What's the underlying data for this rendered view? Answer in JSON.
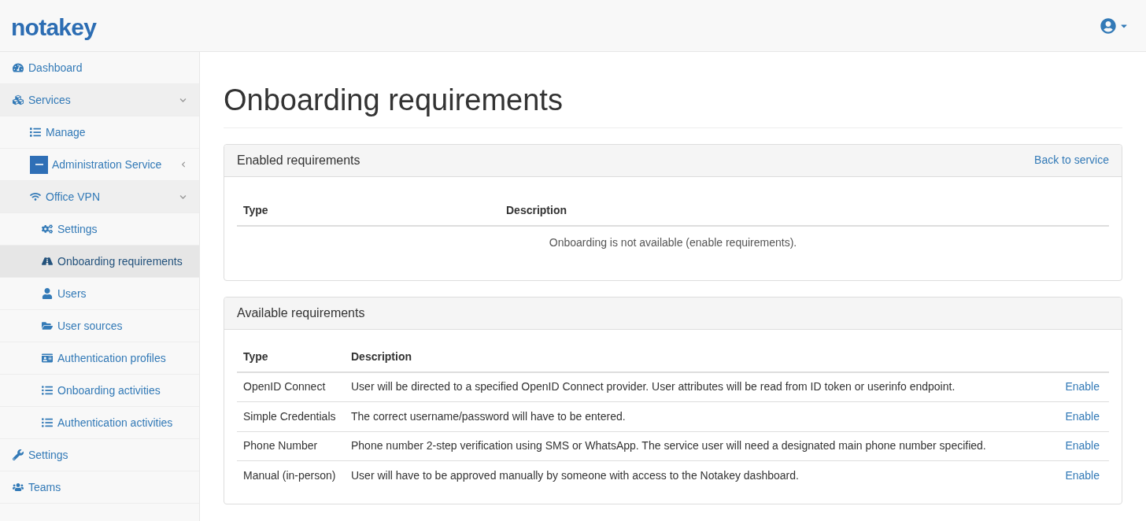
{
  "brand": {
    "name": "notakey"
  },
  "sidebar": {
    "items": [
      {
        "label": "Dashboard",
        "selected": false
      },
      {
        "label": "Services",
        "selected": false,
        "expanded": true,
        "children": [
          {
            "label": "Manage",
            "selected": false
          },
          {
            "label": "Administration Service",
            "selected": false,
            "expanded": false
          },
          {
            "label": "Office VPN",
            "selected": false,
            "expanded": true,
            "children": [
              {
                "label": "Settings",
                "selected": false
              },
              {
                "label": "Onboarding requirements",
                "selected": true
              },
              {
                "label": "Users",
                "selected": false
              },
              {
                "label": "User sources",
                "selected": false
              },
              {
                "label": "Authentication profiles",
                "selected": false
              },
              {
                "label": "Onboarding activities",
                "selected": false
              },
              {
                "label": "Authentication activities",
                "selected": false
              }
            ]
          }
        ]
      },
      {
        "label": "Settings",
        "selected": false
      },
      {
        "label": "Teams",
        "selected": false
      }
    ]
  },
  "page": {
    "title": "Onboarding requirements"
  },
  "enabled_panel": {
    "title": "Enabled requirements",
    "link": "Back to service",
    "columns": [
      "Type",
      "Description"
    ],
    "empty_message": "Onboarding is not available (enable requirements)."
  },
  "available_panel": {
    "title": "Available requirements",
    "columns": [
      "Type",
      "Description"
    ],
    "rows": [
      {
        "type": "OpenID Connect",
        "description": "User will be directed to a specified OpenID Connect provider. User attributes will be read from ID token or userinfo endpoint.",
        "action": "Enable"
      },
      {
        "type": "Simple Credentials",
        "description": "The correct username/password will have to be entered.",
        "action": "Enable"
      },
      {
        "type": "Phone Number",
        "description": "Phone number 2-step verification using SMS or WhatsApp. The service user will need a designated main phone number specified.",
        "action": "Enable"
      },
      {
        "type": "Manual (in-person)",
        "description": "User will have to be approved manually by someone with access to the Notakey dashboard.",
        "action": "Enable"
      }
    ]
  }
}
